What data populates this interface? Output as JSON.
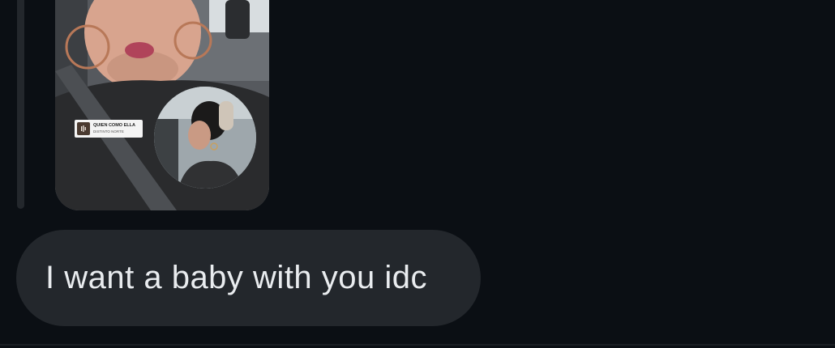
{
  "thread": {
    "story_reply": {
      "music_sticker": {
        "title": "QUIEN COMO ELLA",
        "artist": "DISTINTO NORTE",
        "icon": "music-note-icon"
      }
    },
    "message": {
      "text": "I want a baby with you idc"
    }
  },
  "colors": {
    "background": "#0b0f14",
    "bubble": "#23272c",
    "text": "#e9ecef"
  }
}
